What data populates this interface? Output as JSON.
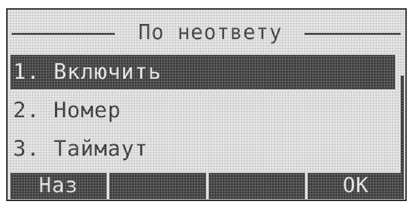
{
  "screen": {
    "title": "По неответу"
  },
  "menu": {
    "items": [
      {
        "label": "1. Включить",
        "selected": true
      },
      {
        "label": "2. Номер",
        "selected": false
      },
      {
        "label": "3. Таймаут",
        "selected": false
      }
    ]
  },
  "softkeys": {
    "key1": "Наз",
    "key2": "",
    "key3": "",
    "key4": "OK"
  }
}
